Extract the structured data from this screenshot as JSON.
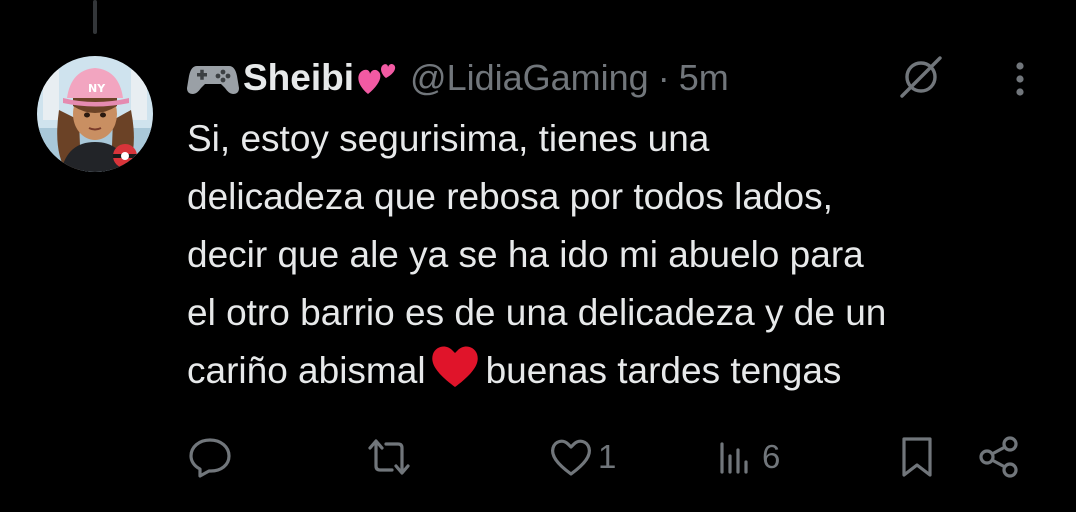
{
  "tweet": {
    "author": {
      "display_name": "Sheibi",
      "handle": "@LidiaGaming",
      "avatar_icon": "avatar-girl-pink-cap"
    },
    "separator": "·",
    "time": "5m",
    "text_lines": [
      "Si, estoy segurisima, tienes una",
      "delicadeza que rebosa por todos lados,",
      "decir que ale ya se ha ido mi abuelo para",
      "el otro barrio es de una delicadeza y de un",
      "cariño abismal",
      "buenas tardes tengas"
    ],
    "emojis": [
      "video-game-controller",
      "two-hearts",
      "red-heart"
    ],
    "actions": {
      "reply": {
        "icon": "reply-icon",
        "count": ""
      },
      "repost": {
        "icon": "repost-icon",
        "count": ""
      },
      "like": {
        "icon": "heart-icon",
        "count": "1"
      },
      "views": {
        "icon": "views-icon",
        "count": "6"
      },
      "bookmark": {
        "icon": "bookmark-icon"
      },
      "share": {
        "icon": "share-icon"
      }
    }
  },
  "colors": {
    "background": "#000000",
    "text_primary": "#e7e9ea",
    "text_secondary": "#71767b",
    "heart_red": "#e0142a",
    "hearts_pink": "#f25aa3"
  }
}
